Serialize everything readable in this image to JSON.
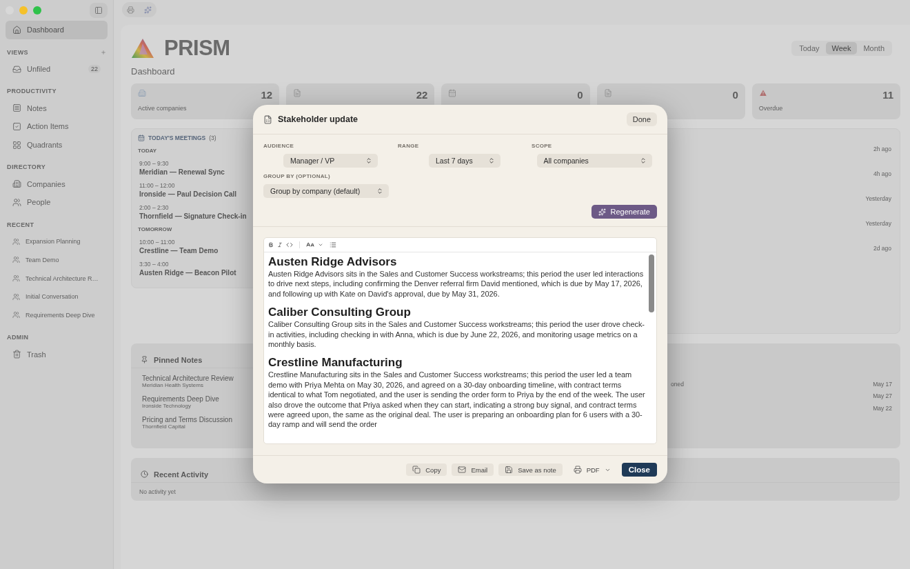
{
  "sidebar": {
    "sections": [
      {
        "items": [
          {
            "label": "Dashboard",
            "kind": "home",
            "selected": true
          }
        ]
      },
      {
        "title": "VIEWS",
        "add": true,
        "items": [
          {
            "label": "Unfiled",
            "kind": "inbox",
            "count": "22",
            "selected": false
          }
        ]
      },
      {
        "title": "PRODUCTIVITY",
        "items": [
          {
            "label": "Notes",
            "kind": "notes",
            "selected": false
          },
          {
            "label": "Action Items",
            "kind": "check",
            "selected": false
          },
          {
            "label": "Quadrants",
            "kind": "grid",
            "selected": false
          }
        ]
      },
      {
        "title": "DIRECTORY",
        "items": [
          {
            "label": "Companies",
            "kind": "building",
            "selected": false
          },
          {
            "label": "People",
            "kind": "people",
            "selected": false
          }
        ]
      },
      {
        "title": "RECENT",
        "items": [
          {
            "label": "Expansion Planning",
            "kind": "recent",
            "selected": false
          },
          {
            "label": "Team Demo",
            "kind": "recent",
            "selected": false
          },
          {
            "label": "Technical Architecture R…",
            "kind": "recent",
            "selected": false
          },
          {
            "label": "Initial Conversation",
            "kind": "recent",
            "selected": false
          },
          {
            "label": "Requirements Deep Dive",
            "kind": "recent",
            "selected": false
          }
        ]
      },
      {
        "title": "ADMIN",
        "items": [
          {
            "label": "Trash",
            "kind": "trash",
            "selected": false
          }
        ]
      }
    ]
  },
  "header": {
    "app_name": "PRISM",
    "subtitle": "Dashboard",
    "periods": [
      {
        "label": "Today",
        "selected": false
      },
      {
        "label": "Week",
        "selected": true
      },
      {
        "label": "Month",
        "selected": false
      }
    ]
  },
  "stats": [
    {
      "kind": "building",
      "value": "12",
      "label": "Active companies"
    },
    {
      "kind": "doc",
      "value": "22"
    },
    {
      "kind": "calendar",
      "value": "0"
    },
    {
      "kind": "doc",
      "value": "0"
    },
    {
      "kind": "alert",
      "value": "11",
      "label": "Overdue"
    }
  ],
  "meetings": {
    "title": "TODAY'S MEETINGS",
    "count": "(3)",
    "groups": [
      {
        "label": "TODAY",
        "items": [
          {
            "time": "9:00 – 9:30",
            "title": "Meridian — Renewal Sync"
          },
          {
            "time": "11:00 – 12:00",
            "title": "Ironside — Paul Decision Call"
          },
          {
            "time": "2:00 – 2:30",
            "title": "Thornfield — Signature Check-in"
          }
        ]
      },
      {
        "label": "TOMORROW",
        "items": [
          {
            "time": "10:00 – 11:00",
            "title": "Crestline — Team Demo"
          },
          {
            "time": "3:30 – 4:00",
            "title": "Austen Ridge — Beacon Pilot"
          }
        ]
      }
    ]
  },
  "activity_times": [
    "2h ago",
    "4h ago",
    "Yesterday",
    "Yesterday",
    "2d ago"
  ],
  "pinned_notes": {
    "title": "Pinned Notes",
    "items": [
      {
        "title": "Technical Architecture Review",
        "company": "Meridian Health Systems"
      },
      {
        "title": "Requirements Deep Dive",
        "company": "Ironside Technology"
      },
      {
        "title": "Pricing and Terms Discussion",
        "company": "Thornfield Capital"
      }
    ]
  },
  "upcoming": [
    {
      "label": "oned",
      "date": "May 17"
    },
    {
      "date": "May 27"
    },
    {
      "date": "May 22"
    }
  ],
  "recent_activity": {
    "title": "Recent Activity",
    "empty": "No activity yet"
  },
  "modal": {
    "title": "Stakeholder update",
    "done": "Done",
    "fields": [
      {
        "label": "AUDIENCE",
        "value": "Manager / VP"
      },
      {
        "label": "RANGE",
        "value": "Last 7 days"
      },
      {
        "label": "SCOPE",
        "value": "All companies"
      }
    ],
    "group_by": {
      "label": "GROUP BY (OPTIONAL)",
      "value": "Group by company (default)"
    },
    "regenerate": "Regenerate",
    "sections": [
      {
        "heading": "Austen Ridge Advisors",
        "body": "Austen Ridge Advisors sits in the Sales and Customer Success workstreams; this period the user led interactions to drive next steps, including confirming the Denver referral firm David mentioned, which is due by May 17, 2026, and following up with Kate on David's approval, due by May 31, 2026."
      },
      {
        "heading": "Caliber Consulting Group",
        "body": "Caliber Consulting Group sits in the Sales and Customer Success workstreams; this period the user drove check-in activities, including checking in with Anna, which is due by June 22, 2026, and monitoring usage metrics on a monthly basis."
      },
      {
        "heading": "Crestline Manufacturing",
        "body": "Crestline Manufacturing sits in the Sales and Customer Success workstreams; this period the user led a team demo with Priya Mehta on May 30, 2026, and agreed on a 30-day onboarding timeline, with contract terms identical to what Tom negotiated, and the user is sending the order form to Priya by the end of the week. The user also drove the outcome that Priya asked when they can start, indicating a strong buy signal, and contract terms were agreed upon, the same as the original deal. The user is preparing an onboarding plan for 6 users with a 30-day ramp and will send the order"
      }
    ],
    "actions": [
      {
        "label": "Copy",
        "kind": "copy"
      },
      {
        "label": "Email",
        "kind": "email"
      },
      {
        "label": "Save as note",
        "kind": "save"
      },
      {
        "label": "PDF",
        "kind": "menu"
      },
      {
        "label": "Close",
        "kind": "primary"
      }
    ]
  }
}
